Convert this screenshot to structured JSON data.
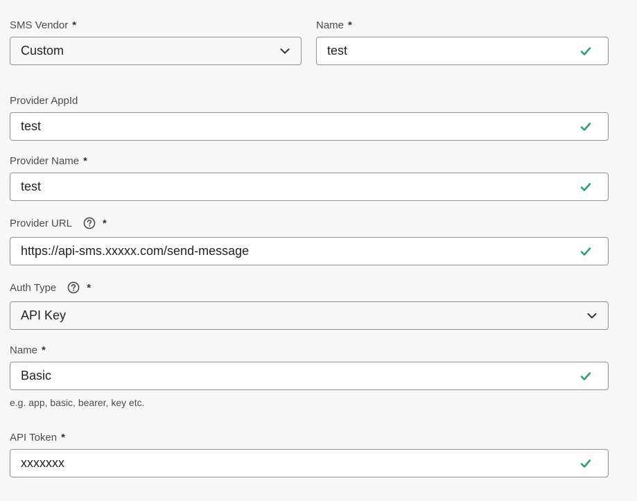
{
  "sms_vendor": {
    "label": "SMS Vendor",
    "required_mark": "*",
    "value": "Custom",
    "chevron_icon": "chevron-down-icon"
  },
  "name": {
    "label": "Name",
    "required_mark": "*",
    "value": "test",
    "status_icon": "checkmark-icon"
  },
  "provider_appid": {
    "label": "Provider AppId",
    "value": "test",
    "status_icon": "checkmark-icon"
  },
  "provider_name": {
    "label": "Provider Name",
    "required_mark": "*",
    "value": "test",
    "status_icon": "checkmark-icon"
  },
  "provider_url": {
    "label": "Provider URL",
    "required_mark": "*",
    "help_icon": "help-circle-icon",
    "value": "https://api-sms.xxxxx.com/send-message",
    "status_icon": "checkmark-icon"
  },
  "auth_type": {
    "label": "Auth Type",
    "required_mark": "*",
    "help_icon": "help-circle-icon",
    "value": "API Key",
    "chevron_icon": "chevron-down-icon"
  },
  "auth_name": {
    "label": "Name",
    "required_mark": "*",
    "value": "Basic",
    "helper_text": "e.g. app, basic, bearer, key etc.",
    "status_icon": "checkmark-icon"
  },
  "api_token": {
    "label": "API Token",
    "required_mark": "*",
    "value": "xxxxxxx",
    "status_icon": "checkmark-icon"
  },
  "colors": {
    "background": "#f8f8f8",
    "border": "#8f8f8f",
    "valid_check": "#2d9d78",
    "label_text": "#4b4b4b",
    "value_text": "#222222"
  }
}
